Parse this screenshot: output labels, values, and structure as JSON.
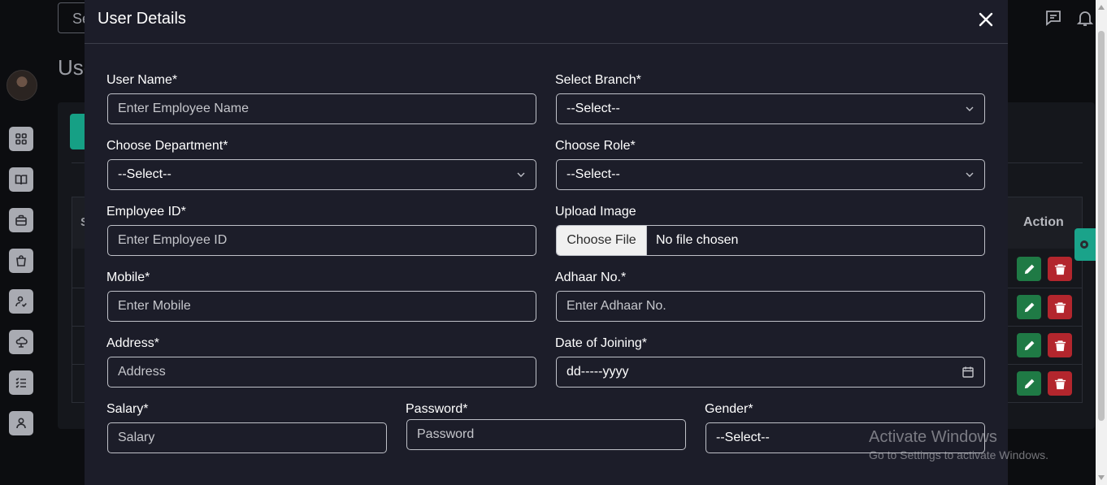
{
  "background": {
    "search_placeholder": "Se",
    "page_title": "Use",
    "table": {
      "first_header": "S",
      "action_header": "Action",
      "row_count": 4
    },
    "colors": {
      "teal": "#16a085",
      "edit": "#1f7a45",
      "delete": "#b3262d"
    },
    "sidebar_icons": [
      "grid-icon",
      "book-icon",
      "briefcase-icon",
      "shopping-bag-icon",
      "user-check-icon",
      "cloud-icon",
      "list-check-icon",
      "user-icon"
    ],
    "header_icons": [
      "message-icon",
      "bell-icon"
    ]
  },
  "modal": {
    "title": "User Details",
    "fields": {
      "user_name": {
        "label": "User Name*",
        "placeholder": "Enter Employee Name"
      },
      "branch": {
        "label": "Select Branch*",
        "value": "--Select--"
      },
      "department": {
        "label": "Choose Department*",
        "value": "--Select--"
      },
      "role": {
        "label": "Choose Role*",
        "value": "--Select--"
      },
      "employee_id": {
        "label": "Employee ID*",
        "placeholder": "Enter Employee ID"
      },
      "upload_image": {
        "label": "Upload Image",
        "button": "Choose File",
        "status": "No file chosen"
      },
      "mobile": {
        "label": "Mobile*",
        "placeholder": "Enter Mobile"
      },
      "adhaar": {
        "label": "Adhaar No.*",
        "placeholder": "Enter Adhaar No."
      },
      "address": {
        "label": "Address*",
        "placeholder": "Address"
      },
      "date_of_joining": {
        "label": "Date of Joining*",
        "value": "dd-----yyyy"
      },
      "salary": {
        "label": "Salary*",
        "placeholder": "Salary"
      },
      "password": {
        "label": "Password*",
        "placeholder": "Password"
      },
      "gender": {
        "label": "Gender*",
        "value": "--Select--"
      }
    }
  },
  "watermark": {
    "line1": "Activate Windows",
    "line2": "Go to Settings to activate Windows."
  }
}
